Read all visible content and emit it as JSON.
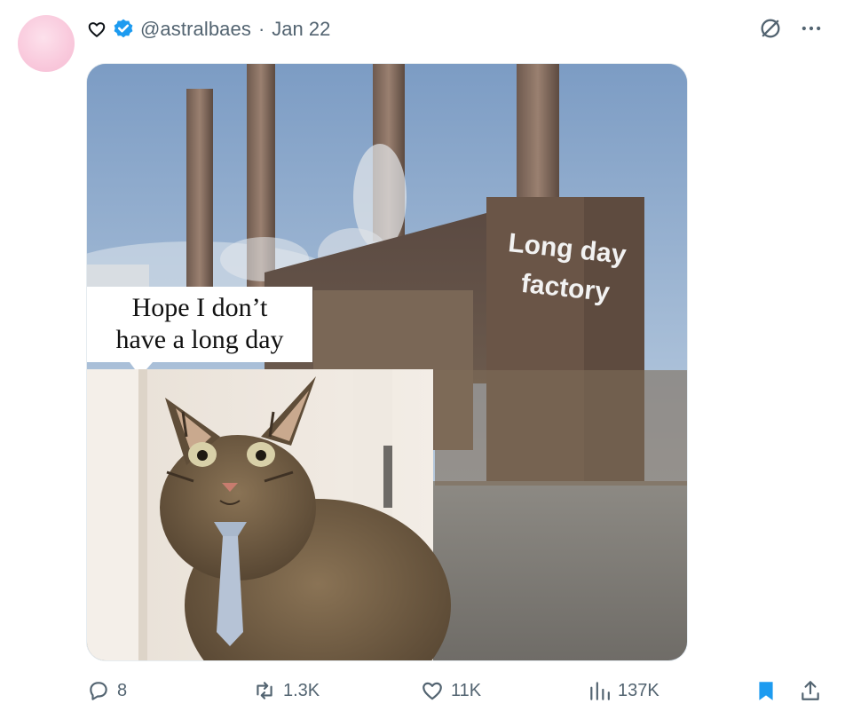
{
  "post": {
    "handle": "@astralbaes",
    "separator": "·",
    "date": "Jan 22"
  },
  "meme": {
    "speech_bubble_line1": "Hope I don’t",
    "speech_bubble_line2": "have a long day",
    "factory_sign_line1": "Long day",
    "factory_sign_line2": "factory"
  },
  "actions": {
    "replies": "8",
    "reposts": "1.3K",
    "likes": "11K",
    "views": "137K"
  },
  "icons": [
    "heart-outline-icon",
    "verified-badge-icon",
    "grok-icon",
    "more-icon",
    "reply-icon",
    "repost-icon",
    "like-icon",
    "views-icon",
    "bookmark-icon",
    "share-icon"
  ],
  "colors": {
    "text_secondary": "#536471",
    "verified_blue": "#1d9bf0",
    "bookmark_blue": "#1d9bf0"
  }
}
